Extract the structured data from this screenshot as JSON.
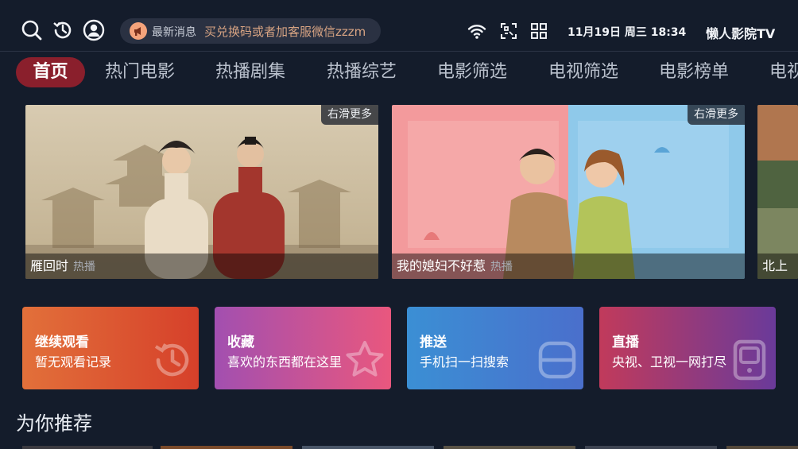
{
  "header": {
    "news_label": "最新消息",
    "news_ticker": "买兑换码或者加客服微信zzzm",
    "datetime": "11月19日 周三 18:34",
    "brand": "懒人影院TV",
    "icons": [
      "search-icon",
      "history-icon",
      "user-icon",
      "megaphone-icon",
      "wifi-icon",
      "scan-icon",
      "apps-grid-icon"
    ]
  },
  "nav": {
    "tabs": [
      {
        "label": "首页",
        "active": true
      },
      {
        "label": "热门电影"
      },
      {
        "label": "热播剧集"
      },
      {
        "label": "热播综艺"
      },
      {
        "label": "电影筛选"
      },
      {
        "label": "电视筛选"
      },
      {
        "label": "电影榜单"
      },
      {
        "label": "电视"
      }
    ]
  },
  "banners": [
    {
      "title": "雁回时",
      "tag": "热播",
      "more": "右滑更多"
    },
    {
      "title": "我的媳妇不好惹",
      "tag": "热播",
      "more": "右滑更多"
    },
    {
      "title": "北上",
      "tag": "",
      "more": ""
    }
  ],
  "cards": [
    {
      "title": "继续观看",
      "subtitle": "暂无观看记录",
      "icon": "history-icon"
    },
    {
      "title": "收藏",
      "subtitle": "喜欢的东西都在这里",
      "icon": "star-icon"
    },
    {
      "title": "推送",
      "subtitle": "手机扫一扫搜索",
      "icon": "scan-icon"
    },
    {
      "title": "直播",
      "subtitle": "央视、卫视一网打尽",
      "icon": "tv-icon"
    }
  ],
  "section_title": "为你推荐",
  "colors": {
    "background": "#141c2b",
    "active_tab": "#8a1f2c",
    "ticker_text": "#d8a483",
    "card_continue": [
      "#e2703a",
      "#d6402a"
    ],
    "card_favorite": [
      "#a24fb0",
      "#e9577e"
    ],
    "card_push": [
      "#3b8fd4",
      "#4a6fcc"
    ],
    "card_live": [
      "#c13a5b",
      "#6a3a9a"
    ]
  }
}
